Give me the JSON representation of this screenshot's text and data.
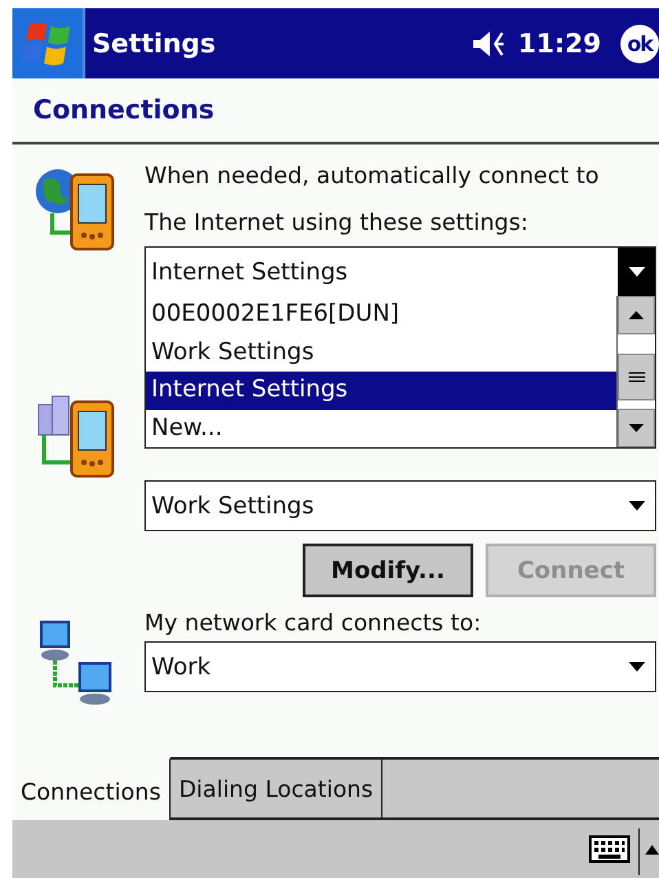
{
  "title_bar": {
    "title": "Settings",
    "time": "11:29",
    "ok_label": "ok"
  },
  "page_title": "Connections",
  "internet_section": {
    "description": "When needed, automatically connect to The Internet using these settings:",
    "dropdown": {
      "value": "Internet Settings",
      "expanded": true,
      "options": [
        {
          "label": "00E0002E1FE6[DUN]",
          "selected": false
        },
        {
          "label": "Work Settings",
          "selected": false
        },
        {
          "label": "Internet Settings",
          "selected": true
        },
        {
          "label": "New...",
          "selected": false
        }
      ]
    }
  },
  "work_section": {
    "dropdown": {
      "value": "Work Settings",
      "expanded": false
    }
  },
  "buttons": [
    {
      "label": "Modify...",
      "disabled": false
    },
    {
      "label": "Connect",
      "disabled": true
    }
  ],
  "network_section": {
    "label": "My network card connects to:",
    "dropdown": {
      "value": "Work",
      "expanded": false
    }
  },
  "tabs": [
    {
      "label": "Connections",
      "selected": true
    },
    {
      "label": "Dialing Locations",
      "selected": false
    }
  ]
}
